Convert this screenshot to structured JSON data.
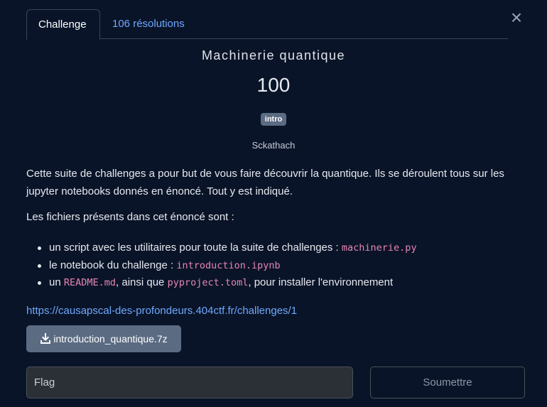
{
  "tabs": [
    {
      "label": "Challenge",
      "active": true
    },
    {
      "label": "106 résolutions",
      "active": false
    }
  ],
  "close_label": "×",
  "challenge": {
    "title": "Machinerie quantique",
    "points": "100",
    "tag": "intro",
    "author": "Sckathach"
  },
  "description": {
    "paragraph1": "Cette suite de challenges a pour but de vous faire découvrir la quantique. Ils se déroulent tous sur les jupyter notebooks donnés en énoncé. Tout y est indiqué.",
    "paragraph2": "Les fichiers présents dans cet énoncé sont :",
    "items": [
      {
        "text1": "un script avec les utilitaires pour toute la suite de challenges : ",
        "code1": "machinerie.py"
      },
      {
        "text1": "le notebook du challenge : ",
        "code1": "introduction.ipynb"
      },
      {
        "text1": "un ",
        "code1": "README.md",
        "text2": ", ainsi que ",
        "code2": "pyproject.toml",
        "text3": ", pour installer l'environnement"
      }
    ],
    "link": "https://causapscal-des-profondeurs.404ctf.fr/challenges/1"
  },
  "download": {
    "label": "introduction_quantique.7z",
    "icon": "download-icon"
  },
  "flag_input": {
    "placeholder": "Flag",
    "value": ""
  },
  "submit_label": "Soumettre",
  "colors": {
    "background": "#0a1428",
    "link": "#6ea8fe",
    "code": "#e685b5",
    "button": "#5b6b82"
  }
}
